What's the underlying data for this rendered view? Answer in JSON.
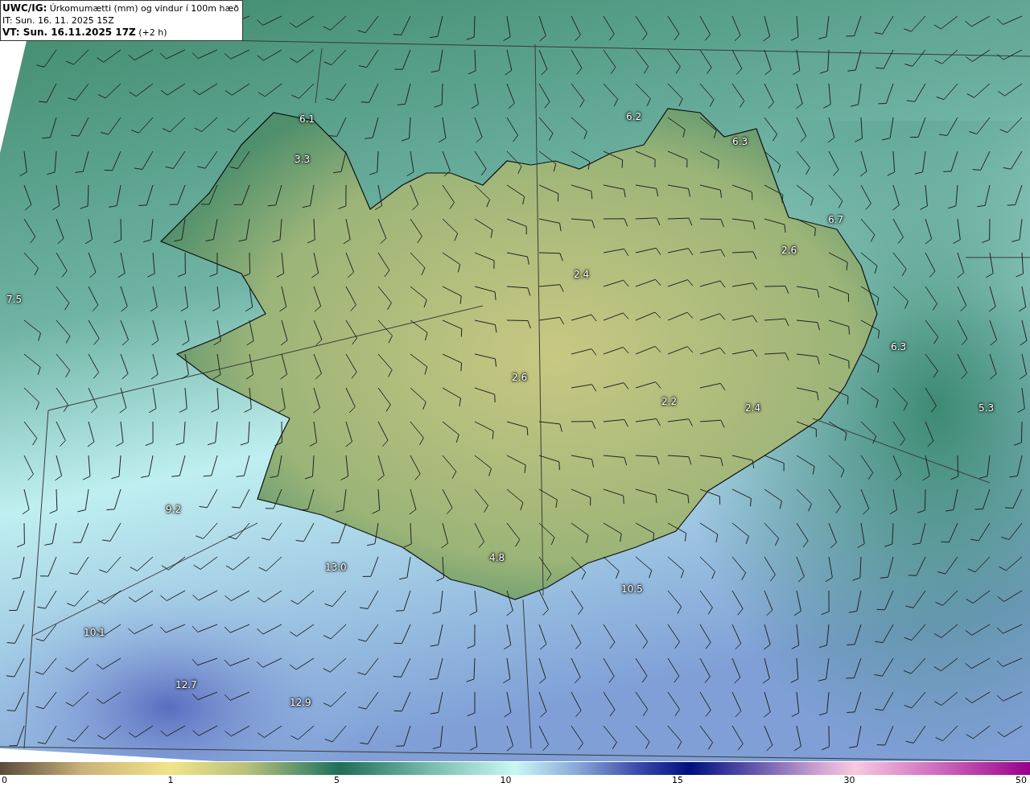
{
  "header": {
    "product": "UWC/IG:",
    "title": "Úrkomumætti (mm) og vindur í 100m hæð",
    "issue_time": "IT: Sun. 16. 11. 2025 15Z",
    "valid_time": "VT: Sun. 16.11.2025 17Z",
    "lead": "(+2 h)"
  },
  "map_labels": [
    "6.1",
    "6.2",
    "6.3",
    "3.3",
    "6.7",
    "2.6",
    "7.5",
    "2.4",
    "6.3",
    "2.6",
    "2.2",
    "2.4",
    "5.3",
    "9.2",
    "4.8",
    "13.0",
    "10.5",
    "10.1",
    "12.7",
    "12.9"
  ],
  "colorbar": {
    "ticks": [
      "0",
      "1",
      "5",
      "10",
      "15",
      "30",
      "50"
    ]
  }
}
